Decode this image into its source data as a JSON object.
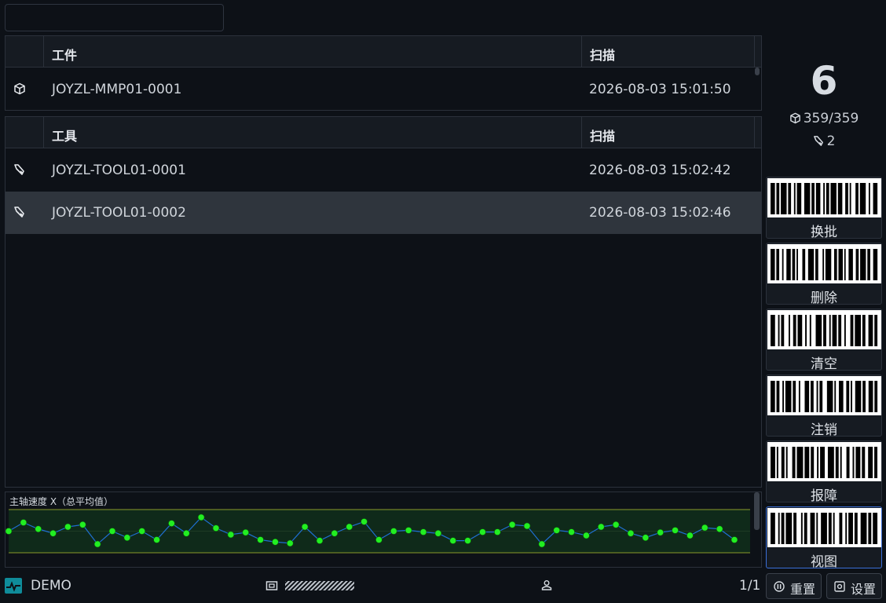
{
  "search": {
    "value": "",
    "placeholder": ""
  },
  "workpiece_table": {
    "headers": {
      "name": "工件",
      "scan": "扫描"
    },
    "rows": [
      {
        "icon": "box-icon",
        "name": "JOYZL-MMP01-0001",
        "scan": "2026-08-03 15:01:50"
      }
    ]
  },
  "tool_table": {
    "headers": {
      "name": "工具",
      "scan": "扫描"
    },
    "rows": [
      {
        "icon": "tool-icon",
        "name": "JOYZL-TOOL01-0001",
        "scan": "2026-08-03 15:02:42",
        "selected": false
      },
      {
        "icon": "tool-icon",
        "name": "JOYZL-TOOL01-0002",
        "scan": "2026-08-03 15:02:46",
        "selected": true
      }
    ]
  },
  "chart_data": {
    "type": "line",
    "title": "主轴速度 X（总平均值）",
    "xlabel": "",
    "ylabel": "",
    "ylim": [
      0,
      100
    ],
    "upper_limit": 100,
    "lower_limit": 0,
    "colors": {
      "points": "#22ee22",
      "line": "#1f6fd1",
      "limits": "#8a9a2a",
      "band": "#0f2a1a"
    },
    "series": [
      {
        "values": [
          50,
          70,
          55,
          45,
          60,
          65,
          20,
          50,
          35,
          50,
          30,
          68,
          45,
          82,
          57,
          42,
          47,
          30,
          25,
          22,
          60,
          28,
          45,
          60,
          72,
          30,
          50,
          52,
          48,
          45,
          28,
          28,
          48,
          48,
          65,
          62,
          20,
          52,
          48,
          40,
          60,
          65,
          45,
          35,
          47,
          52,
          40,
          58,
          55,
          30
        ]
      }
    ]
  },
  "summary": {
    "count": "6",
    "workpieces": "359/359",
    "tools": "2"
  },
  "actions": [
    {
      "label": "换批",
      "name": "change-batch-button",
      "pattern": [
        3,
        1,
        2,
        1,
        4,
        1,
        2,
        2,
        1,
        1,
        3,
        2,
        4,
        1,
        2,
        1,
        3,
        2,
        1,
        1,
        2,
        1,
        4,
        1,
        3,
        2,
        2,
        1,
        1,
        3,
        2,
        1,
        4,
        2,
        1,
        2,
        3,
        1
      ]
    },
    {
      "label": "删除",
      "name": "delete-button",
      "pattern": [
        3,
        1,
        2,
        2,
        1,
        2,
        3,
        1,
        2,
        1,
        1,
        3,
        2,
        2,
        4,
        1,
        2,
        3,
        1,
        1,
        4,
        2,
        2,
        1,
        3,
        1,
        1,
        2,
        3,
        2,
        2,
        1,
        4,
        1,
        2,
        2,
        3,
        1
      ]
    },
    {
      "label": "清空",
      "name": "clear-button",
      "pattern": [
        3,
        2,
        1,
        1,
        2,
        3,
        1,
        2,
        2,
        1,
        3,
        2,
        1,
        2,
        1,
        3,
        4,
        1,
        2,
        2,
        1,
        1,
        3,
        1,
        2,
        2,
        1,
        3,
        2,
        1,
        4,
        1,
        2,
        2,
        3,
        1,
        2,
        1
      ]
    },
    {
      "label": "注销",
      "name": "logout-button",
      "pattern": [
        3,
        1,
        2,
        2,
        1,
        1,
        4,
        1,
        2,
        2,
        1,
        3,
        3,
        1,
        2,
        2,
        1,
        1,
        2,
        3,
        4,
        1,
        1,
        2,
        3,
        2,
        2,
        1,
        1,
        2,
        4,
        1,
        2,
        2,
        3,
        1,
        2,
        1
      ]
    },
    {
      "label": "报障",
      "name": "report-fault-button",
      "pattern": [
        3,
        1,
        1,
        2,
        2,
        1,
        1,
        3,
        2,
        1,
        4,
        1,
        3,
        1,
        2,
        2,
        1,
        1,
        3,
        2,
        4,
        1,
        2,
        1,
        1,
        3,
        2,
        2,
        1,
        1,
        3,
        1,
        2,
        2,
        3,
        1,
        2,
        1
      ]
    },
    {
      "label": "视图",
      "name": "view-button",
      "pattern": [
        3,
        2,
        1,
        1,
        2,
        1,
        4,
        1,
        2,
        3,
        1,
        1,
        2,
        2,
        3,
        1,
        1,
        2,
        4,
        1,
        2,
        1,
        1,
        3,
        2,
        2,
        1,
        1,
        3,
        1,
        2,
        2,
        4,
        1,
        2,
        1,
        3,
        1
      ]
    }
  ],
  "status_bar": {
    "app_name": "DEMO",
    "page": "1/1",
    "reset_label": "重置",
    "settings_label": "设置"
  }
}
